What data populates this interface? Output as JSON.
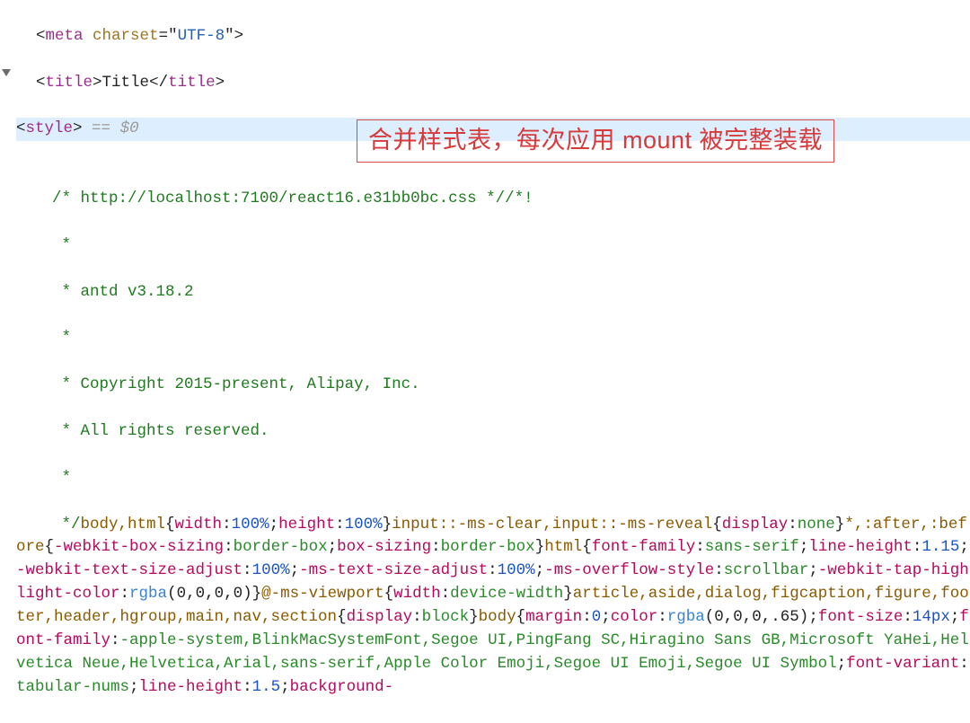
{
  "lines": {
    "meta_open": "<",
    "meta_tag": "meta",
    "meta_sp": " ",
    "meta_attr": "charset",
    "meta_eq": "=",
    "meta_q1": "\"",
    "meta_val": "UTF-8",
    "meta_q2": "\"",
    "meta_close": ">",
    "title_open": "<",
    "title_tag": "title",
    "title_gt": ">",
    "title_text": "Title",
    "title_co": "</",
    "title_tag2": "title",
    "title_ce": ">",
    "style_open": "<",
    "style_tag": "style",
    "style_gt": ">",
    "style_eq": " == ",
    "style_ref": "$0",
    "c1": "/* http://localhost:7100/react16.e31bb0bc.css *//*!",
    "c2": " *",
    "c3": " * antd v3.18.2",
    "c4": " *",
    "c5": " * Copyright 2015-present, Alipay, Inc.",
    "c6": " * All rights reserved.",
    "c7": " *",
    "c8": " */"
  },
  "css": {
    "s1_sel": "body,html",
    "s1_p1": "width",
    "s1_v1": "100%",
    "s1_p2": "height",
    "s1_v2": "100%",
    "s2_sel": "input::-ms-clear,input::-ms-reveal",
    "s2_p1": "display",
    "s2_v1": "none",
    "s3_sel": "*,:after,:before",
    "s3_p1": "-webkit-box-sizing",
    "s3_v1": "border-box",
    "s3_p2": "box-sizing",
    "s3_v2": "border-box",
    "s4_sel": "html",
    "s4_p1": "font-family",
    "s4_v1": "sans-serif",
    "s4_p2": "line-height",
    "s4_v2": "1.15",
    "s4_p3": "-webkit-text-size-adjust",
    "s4_v3": "100%",
    "s4_p4": "-ms-text-size-adjust",
    "s4_v4": "100%",
    "s4_p5": "-ms-overflow-style",
    "s4_v5": "scrollbar",
    "s4_p6": "-webkit-tap-highlight-color",
    "s4_v6f": "rgba",
    "s4_v6a": "(0,0,0,0)",
    "s5_at": "@-ms-viewport",
    "s5_p1": "width",
    "s5_v1": "device-width",
    "s6_sel": "article,aside,dialog,figcaption,figure,footer,header,hgroup,main,nav,section",
    "s6_p1": "display",
    "s6_v1": "block",
    "s7_sel": "body",
    "s7_p1": "margin",
    "s7_v1": "0",
    "s7_p2": "color",
    "s7_v2f": "rgba",
    "s7_v2a": "(0,0,0,.65)",
    "s7_p3": "font-size",
    "s7_v3": "14px",
    "s7_p4": "font-family",
    "s7_v4": "-apple-system,BlinkMacSystemFont,Segoe UI,PingFang SC,Hiragino Sans GB,Microsoft YaHei,Helvetica Neue,Helvetica,Arial,sans-serif,Apple Color Emoji,Segoe UI Emoji,Segoe UI Symbol",
    "s7_p5": "font-variant",
    "s7_v5": "tabular-nums",
    "s7_p6": "line-height",
    "s7_v6": "1.5",
    "s7_p7": "background-"
  },
  "annotation": {
    "text": "合并样式表，每次应用 mount 被完整装载"
  }
}
